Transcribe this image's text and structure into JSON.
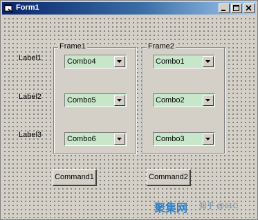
{
  "window": {
    "title": "Form1"
  },
  "labels": [
    "Label1",
    "Label2",
    "Label3"
  ],
  "frames": [
    {
      "caption": "Frame1",
      "combos": [
        "Combo4",
        "Combo5",
        "Combo6"
      ]
    },
    {
      "caption": "Frame2",
      "combos": [
        "Combo1",
        "Combo2",
        "Combo3"
      ]
    }
  ],
  "buttons": {
    "command1": "Command1",
    "command2": "Command2"
  },
  "watermark": {
    "brand": "聚集网",
    "text": "知乎 @61C"
  },
  "colors": {
    "combo_bg": "#c8e6c9",
    "titlebar": "#0a246a"
  },
  "icons": [
    "form-icon",
    "minimize-icon",
    "maximize-icon",
    "close-icon",
    "dropdown-arrow-icon"
  ]
}
